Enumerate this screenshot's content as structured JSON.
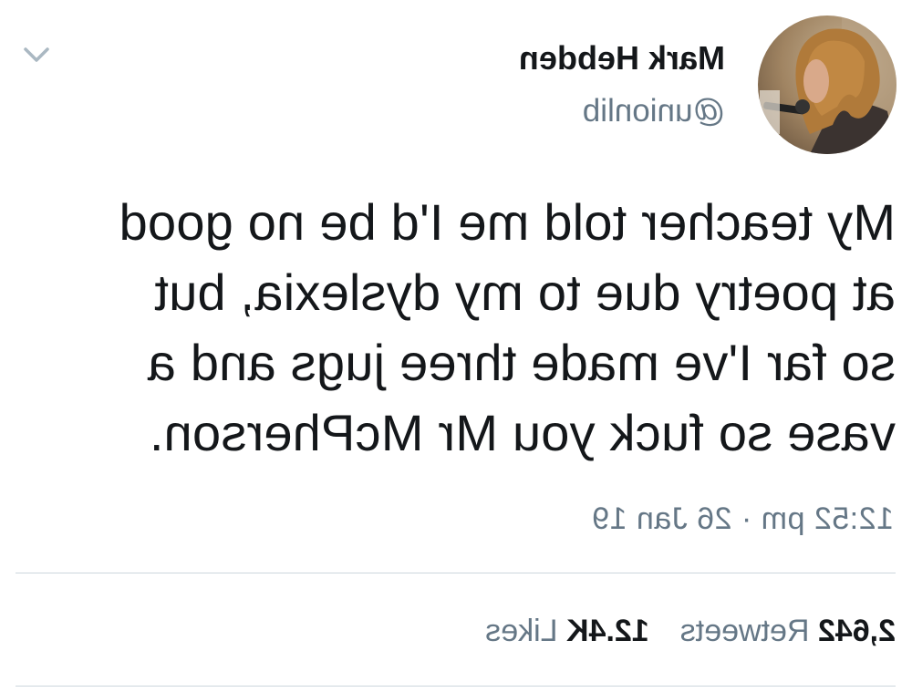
{
  "author": {
    "display_name": "Mark Hebden",
    "handle": "@unionlib"
  },
  "avatar_icon": "profile-photo",
  "menu_icon": "chevron-down-icon",
  "tweet": {
    "lines": [
      "My teacher told me I'd be no good",
      "at poetry due to my dyslexia, but",
      "so far I've made three jugs and a",
      "vase so fuck you Mr McPherson."
    ],
    "timestamp": "12:52 pm · 26 Jan 19"
  },
  "stats": {
    "retweets_count": "2,642",
    "retweets_label": "Retweets",
    "likes_count": "12.4K",
    "likes_label": "Likes"
  },
  "colors": {
    "text_primary": "#14171a",
    "text_secondary": "#657786",
    "divider": "#ccd6dd",
    "caret": "#aab8c2"
  }
}
